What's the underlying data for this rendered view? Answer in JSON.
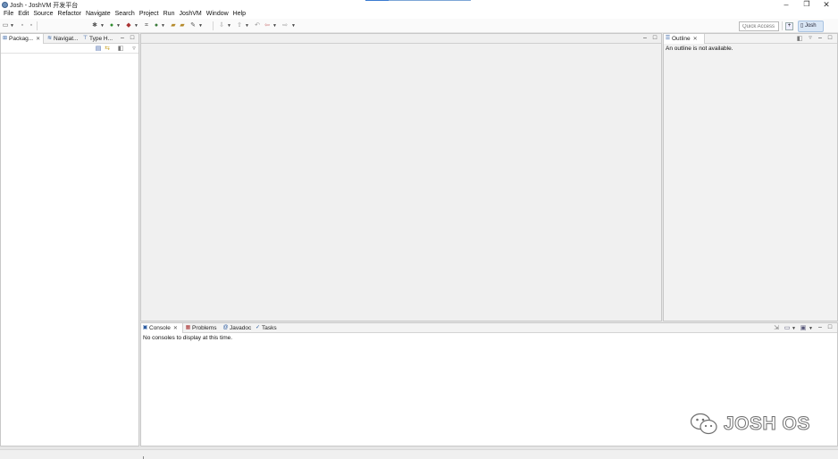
{
  "window": {
    "title": "Josh - JoshVM 开发平台",
    "title_progress": 0.22,
    "minimize": "–",
    "maximize": "❐",
    "close": "✕"
  },
  "menu": [
    "File",
    "Edit",
    "Source",
    "Refactor",
    "Navigate",
    "Search",
    "Project",
    "Run",
    "JoshVM",
    "Window",
    "Help"
  ],
  "toolbar": {
    "quick_access_placeholder": "Quick Access",
    "perspective_label": "Josh",
    "open_perspective_icon": "open-perspective-icon"
  },
  "left_panel": {
    "tabs": [
      {
        "label": "Packag...",
        "icon": "package-explorer-icon",
        "close": "✕"
      },
      {
        "label": "Navigat...",
        "icon": "navigator-icon"
      },
      {
        "label": "Type H...",
        "icon": "type-hierarchy-icon"
      }
    ],
    "minimize": "–",
    "maximize": "□"
  },
  "editor": {
    "minimize": "–",
    "maximize": "□"
  },
  "outline": {
    "tab_label": "Outline",
    "close": "✕",
    "message": "An outline is not available.",
    "minimize": "–",
    "maximize": "□"
  },
  "console_panel": {
    "tabs": [
      {
        "label": "Console",
        "close": "✕"
      },
      {
        "label": "Problems"
      },
      {
        "label": "Javadoc"
      },
      {
        "label": "Tasks"
      }
    ],
    "message": "No consoles to display at this time.",
    "minimize": "–",
    "maximize": "□"
  },
  "watermark": {
    "text": "JOSH OS"
  }
}
